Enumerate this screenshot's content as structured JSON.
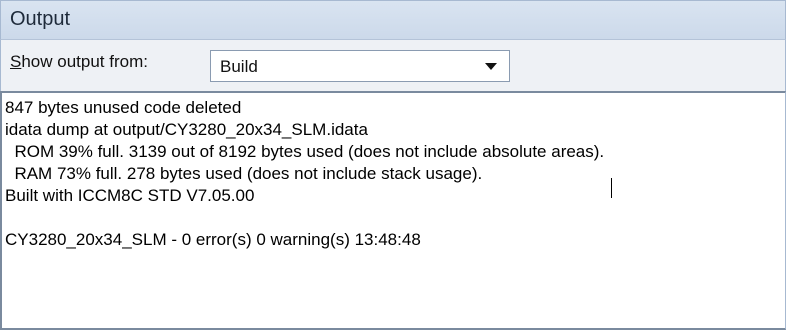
{
  "panel": {
    "title": "Output"
  },
  "toolbar": {
    "show_output_from_label_pre": "S",
    "show_output_from_label_post": "how output from:",
    "source_value": "Build"
  },
  "output": {
    "lines": [
      "847 bytes unused code deleted",
      "idata dump at output/CY3280_20x34_SLM.idata",
      "  ROM 39% full. 3139 out of 8192 bytes used (does not include absolute areas).",
      "  RAM 73% full. 278 bytes used (does not include stack usage).",
      "Built with ICCM8C STD V7.05.00",
      "",
      "CY3280_20x34_SLM - 0 error(s) 0 warning(s) 13:48:48"
    ]
  }
}
